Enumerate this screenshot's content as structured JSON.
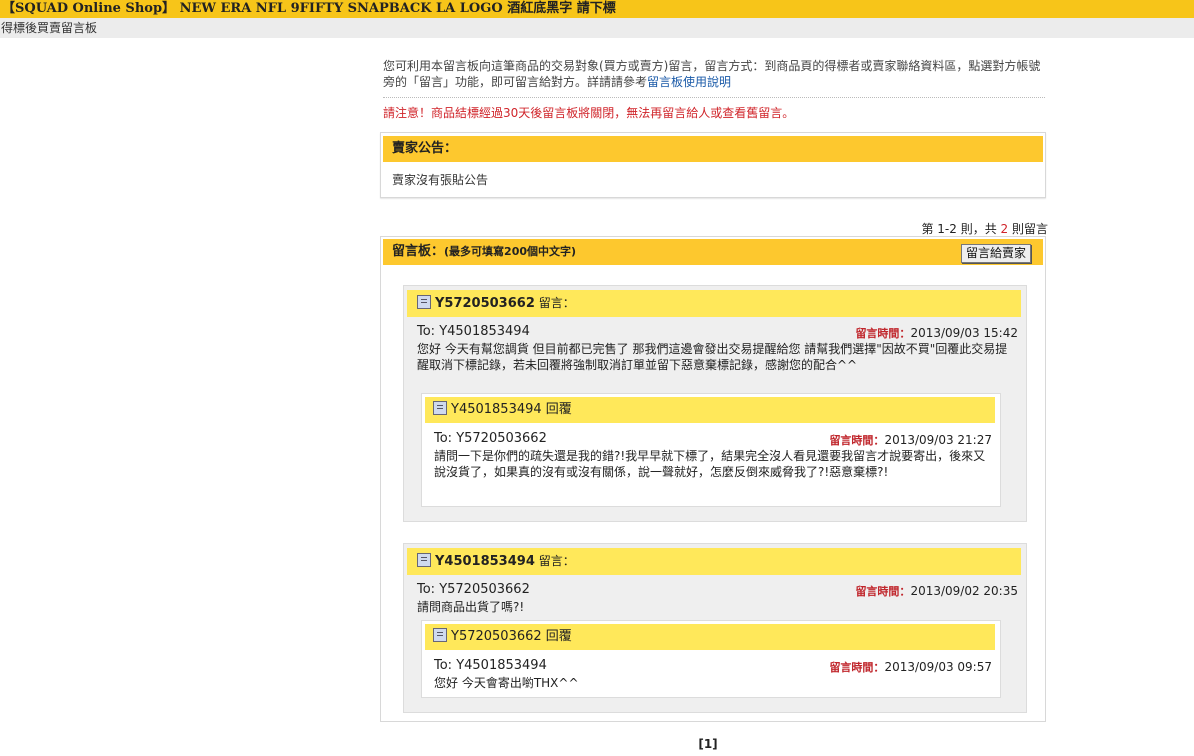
{
  "header": {
    "title": "【SQUAD Online Shop】 NEW ERA NFL 9FIFTY SNAPBACK LA LOGO 酒紅底黑字 請下標",
    "subtitle": "得標後買賣留言板"
  },
  "intro": {
    "text": "您可利用本留言板向這筆商品的交易對象(買方或賣方)留言，留言方式：到商品頁的得標者或賣家聯絡資料區，點選對方帳號旁的「留言」功能，即可留言給對方。詳請請參考",
    "link": "留言板使用說明",
    "warning": "請注意！商品結標經過30天後留言板將關閉，無法再留言給人或查看舊留言。"
  },
  "notice": {
    "title": "賣家公告：",
    "body": "賣家沒有張貼公告"
  },
  "count": {
    "prefix": "第 1-2 則，共 ",
    "total": "2",
    "suffix": " 則留言"
  },
  "board": {
    "title": "留言板：",
    "subtitle": "(最多可填寫200個中文字)",
    "write_button": "留言給賣家"
  },
  "time_label": "留言時間：",
  "messages": [
    {
      "user": "Y5720503662",
      "action": " 留言：",
      "to": "To: Y4501853494",
      "time": "2013/09/03 15:42",
      "body": "您好 今天有幫您調貨 但目前都已完售了 那我們這邊會發出交易提醒給您 請幫我們選擇\"因故不買\"回覆此交易提醒取消下標記錄，若未回覆將強制取消訂單並留下惡意棄標記錄，感謝您的配合^^",
      "reply": {
        "user": "Y4501853494",
        "action": " 回覆",
        "to": "To: Y5720503662",
        "time": "2013/09/03 21:27",
        "body": "請問一下是你們的疏失還是我的錯?!我早早就下標了，結果完全沒人看見還要我留言才說要寄出，後來又說沒貨了，如果真的沒有或沒有關係，說一聲就好，怎麼反倒來威脅我了?!惡意棄標?!"
      }
    },
    {
      "user": "Y4501853494",
      "action": " 留言：",
      "to": "To: Y5720503662",
      "time": "2013/09/02 20:35",
      "body": "請問商品出貨了嗎?!",
      "reply": {
        "user": "Y5720503662",
        "action": " 回覆",
        "to": "To: Y4501853494",
        "time": "2013/09/03 09:57",
        "body": "您好 今天會寄出喲THX^^"
      }
    }
  ],
  "pager": "[1]"
}
